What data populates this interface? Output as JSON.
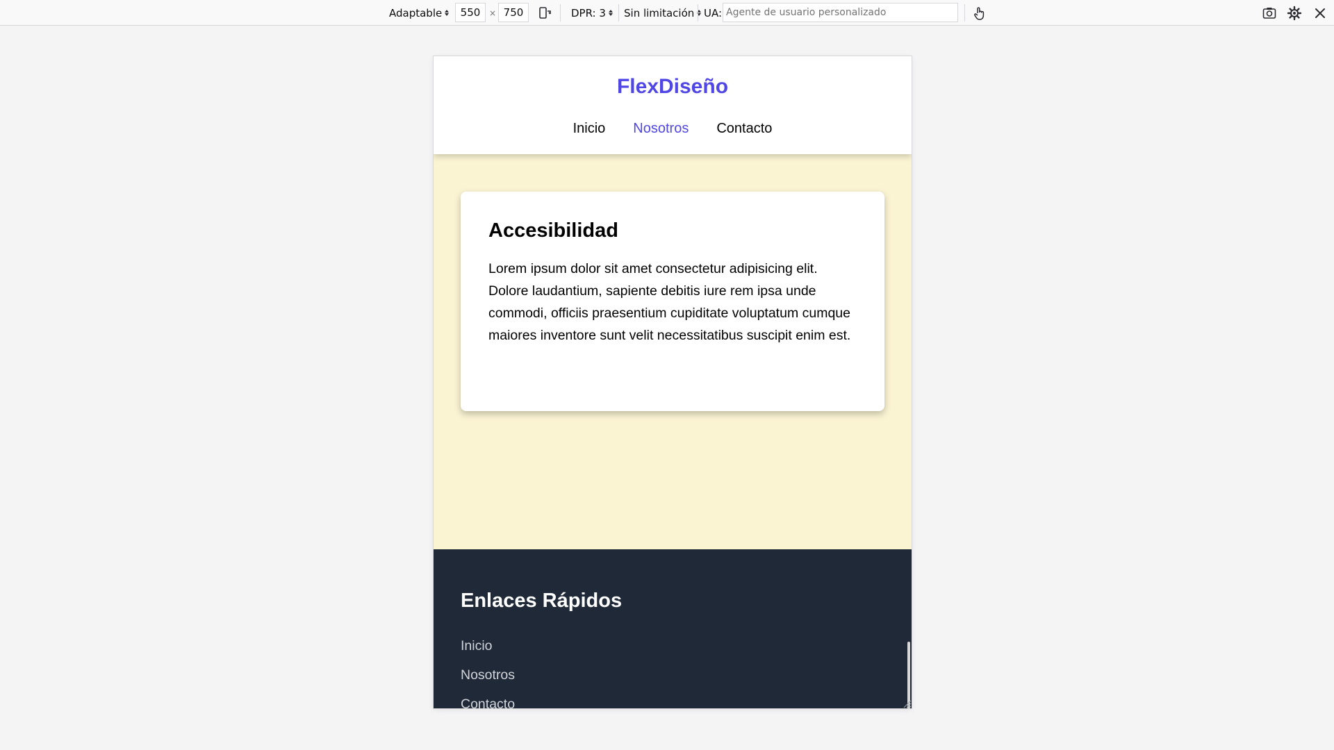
{
  "toolbar": {
    "device": "Adaptable",
    "width": "550",
    "times": "×",
    "height": "750",
    "dpr": "DPR: 3",
    "throttle": "Sin limitación",
    "ua_label": "UA:",
    "ua_placeholder": "Agente de usuario personalizado",
    "icons": [
      "rotate-icon",
      "touch-icon",
      "screenshot-icon",
      "settings-icon",
      "close-icon"
    ]
  },
  "site": {
    "brand": "FlexDiseño",
    "brand_color": "#4f46e5",
    "nav": [
      {
        "label": "Inicio",
        "active": false
      },
      {
        "label": "Nosotros",
        "active": true
      },
      {
        "label": "Contacto",
        "active": false
      }
    ],
    "card": {
      "title": "Accesibilidad",
      "body": "Lorem ipsum dolor sit amet consectetur adipisicing elit. Dolore laudantium, sapiente debitis iure rem ipsa unde commodi, officiis praesentium cupiditate voluptatum cumque maiores inventore sunt velit necessitatibus suscipit enim est."
    },
    "footer": {
      "title": "Enlaces Rápidos",
      "links": [
        "Inicio",
        "Nosotros",
        "Contacto"
      ]
    }
  },
  "colors": {
    "main_bg": "#fbf4d3",
    "footer_bg": "#1f2937"
  }
}
